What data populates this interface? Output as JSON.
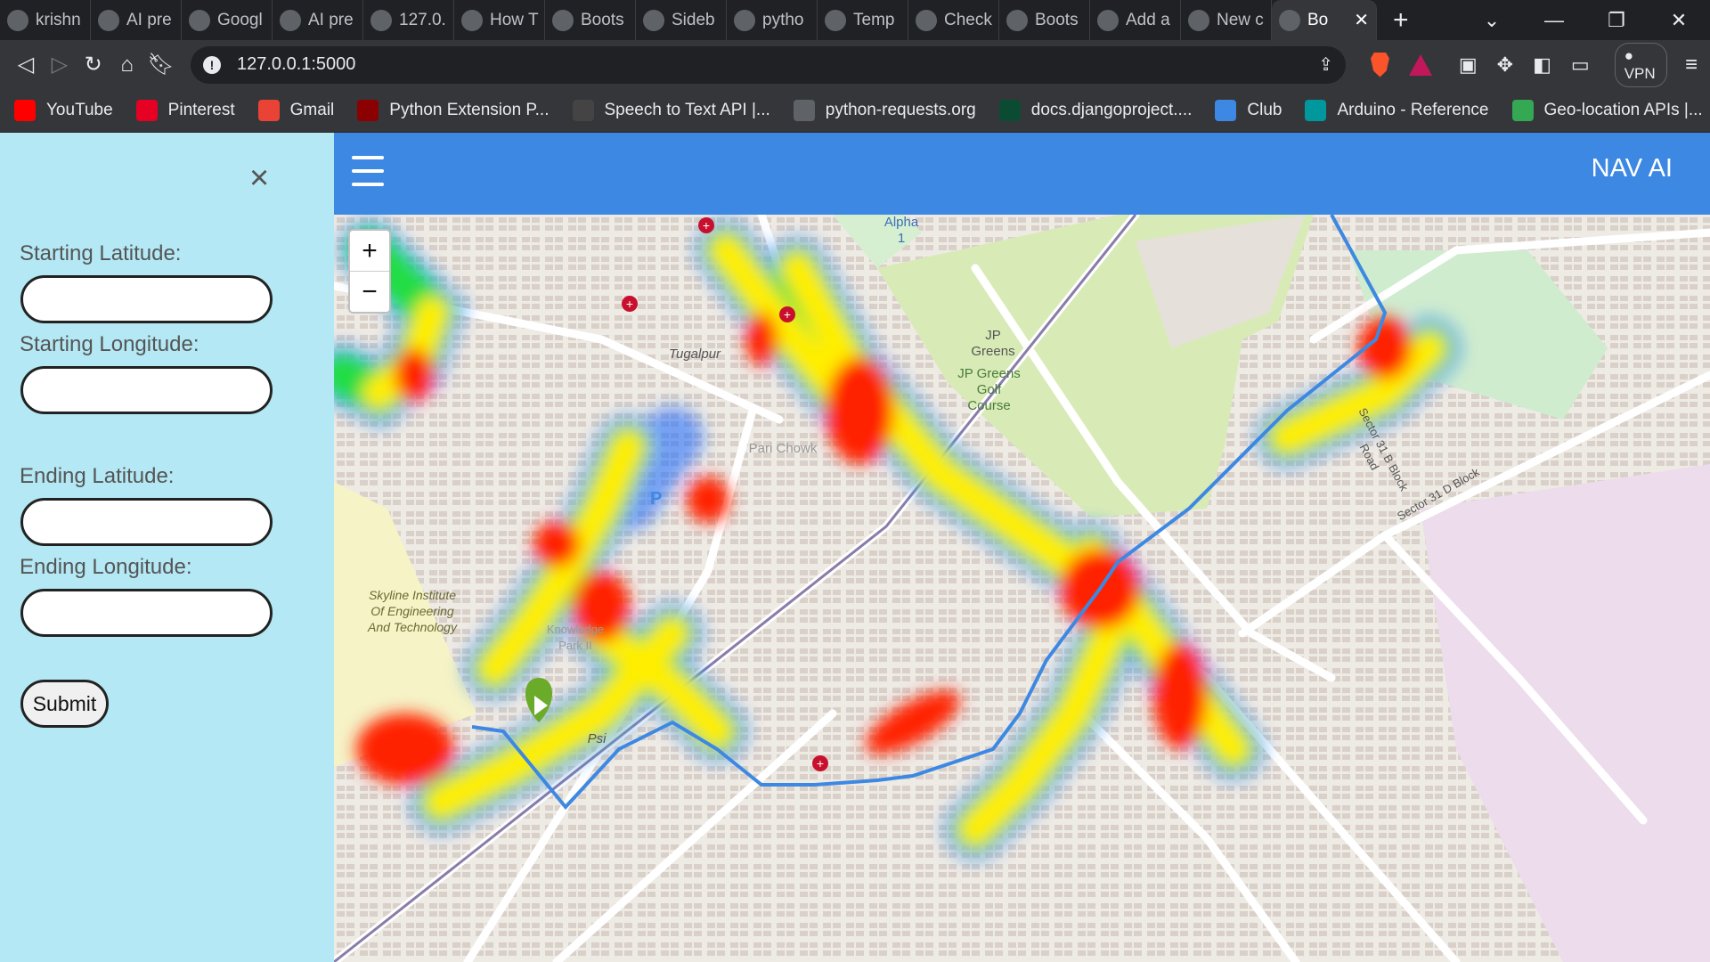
{
  "browser": {
    "tabs": [
      {
        "label": "krishn",
        "icon": "github-icon"
      },
      {
        "label": "AI pre",
        "icon": "globe-icon"
      },
      {
        "label": "Googl",
        "icon": "maps-icon"
      },
      {
        "label": "AI pre",
        "icon": "globe-icon"
      },
      {
        "label": "127.0.",
        "icon": "globe-icon"
      },
      {
        "label": "How T",
        "icon": "w-icon"
      },
      {
        "label": "Boots",
        "icon": "colorlib-icon"
      },
      {
        "label": "Sideb",
        "icon": "wordpress-icon"
      },
      {
        "label": "pytho",
        "icon": "stackoverflow-icon"
      },
      {
        "label": "Temp",
        "icon": "tabnine-icon"
      },
      {
        "label": "Check",
        "icon": "bootstrap-icon"
      },
      {
        "label": "Boots",
        "icon": "globe-icon"
      },
      {
        "label": "Add a",
        "icon": "google-icon"
      },
      {
        "label": "New c",
        "icon": "openai-icon"
      },
      {
        "label": "Bo",
        "icon": "globe-icon",
        "active": true
      }
    ],
    "url": "127.0.0.1:5000",
    "vpn_label": "VPN",
    "bookmarks": [
      {
        "label": "YouTube",
        "icon": "youtube-icon",
        "color": "#ff0000"
      },
      {
        "label": "Pinterest",
        "icon": "pinterest-icon",
        "color": "#e60023"
      },
      {
        "label": "Gmail",
        "icon": "gmail-icon",
        "color": "#ea4335"
      },
      {
        "label": "Python Extension P...",
        "icon": "python-extension-icon",
        "color": "#8b0000"
      },
      {
        "label": "Speech to Text API |...",
        "icon": "speech-icon",
        "color": "#444444"
      },
      {
        "label": "python-requests.org",
        "icon": "globe-icon",
        "color": "#5f6368"
      },
      {
        "label": "docs.djangoproject....",
        "icon": "django-icon",
        "color": "#0c4b33"
      },
      {
        "label": "Club",
        "icon": "club-icon",
        "color": "#3d88e2"
      },
      {
        "label": "Arduino - Reference",
        "icon": "arduino-icon",
        "color": "#00979d"
      },
      {
        "label": "Geo-location APIs |...",
        "icon": "maps-pin-icon",
        "color": "#34a853"
      }
    ]
  },
  "sidebar": {
    "fields": [
      {
        "label": "Starting Latitude:",
        "value": ""
      },
      {
        "label": "Starting Longitude:",
        "value": ""
      },
      {
        "label": "Ending Latitude:",
        "value": ""
      },
      {
        "label": "Ending Longitude:",
        "value": ""
      }
    ],
    "submit_label": "Submit"
  },
  "navbar": {
    "brand": "NAV AI"
  },
  "map": {
    "labels": {
      "alpha": "Alpha 1",
      "tugalpur": "Tugalpur",
      "jp_greens": "JP Greens",
      "golf": "JP Greens Golf Course",
      "pari_chowk": "Pari Chowk",
      "skyline": "Skyline Institute Of Engineering And Technology",
      "knowledge_park": "Knowledge Park II",
      "psi": "Psi",
      "sector_31b": "Sector 31 B Block Road",
      "sector_31d": "Sector 31 D Block"
    },
    "route_color": "#3d88e2"
  }
}
